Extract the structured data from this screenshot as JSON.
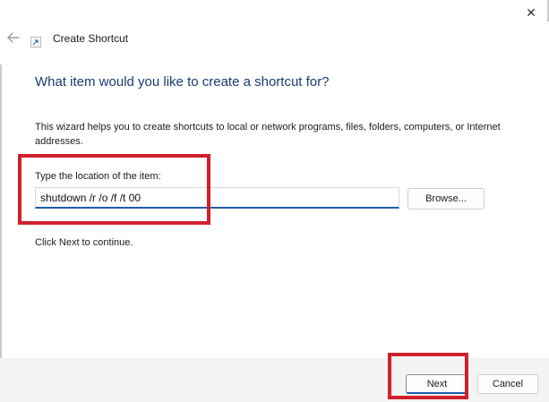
{
  "window": {
    "title": "Create Shortcut",
    "close_glyph": "✕"
  },
  "icons": {
    "back": "back-arrow-icon",
    "shortcut": "shortcut-arrow-icon",
    "close": "close-icon"
  },
  "wizard": {
    "heading": "What item would you like to create a shortcut for?",
    "description": "This wizard helps you to create shortcuts to local or network programs, files, folders, computers, or Internet addresses.",
    "location_label": "Type the location of the item:",
    "location_value": "shutdown /r /o /f /t 00",
    "browse_label": "Browse...",
    "continue_hint": "Click Next to continue."
  },
  "footer": {
    "next_label": "Next",
    "cancel_label": "Cancel"
  },
  "colors": {
    "heading": "#1a3a6e",
    "accent": "#1f5fa8",
    "highlight": "#d0202c",
    "footer_bg": "#f3f3f3"
  }
}
